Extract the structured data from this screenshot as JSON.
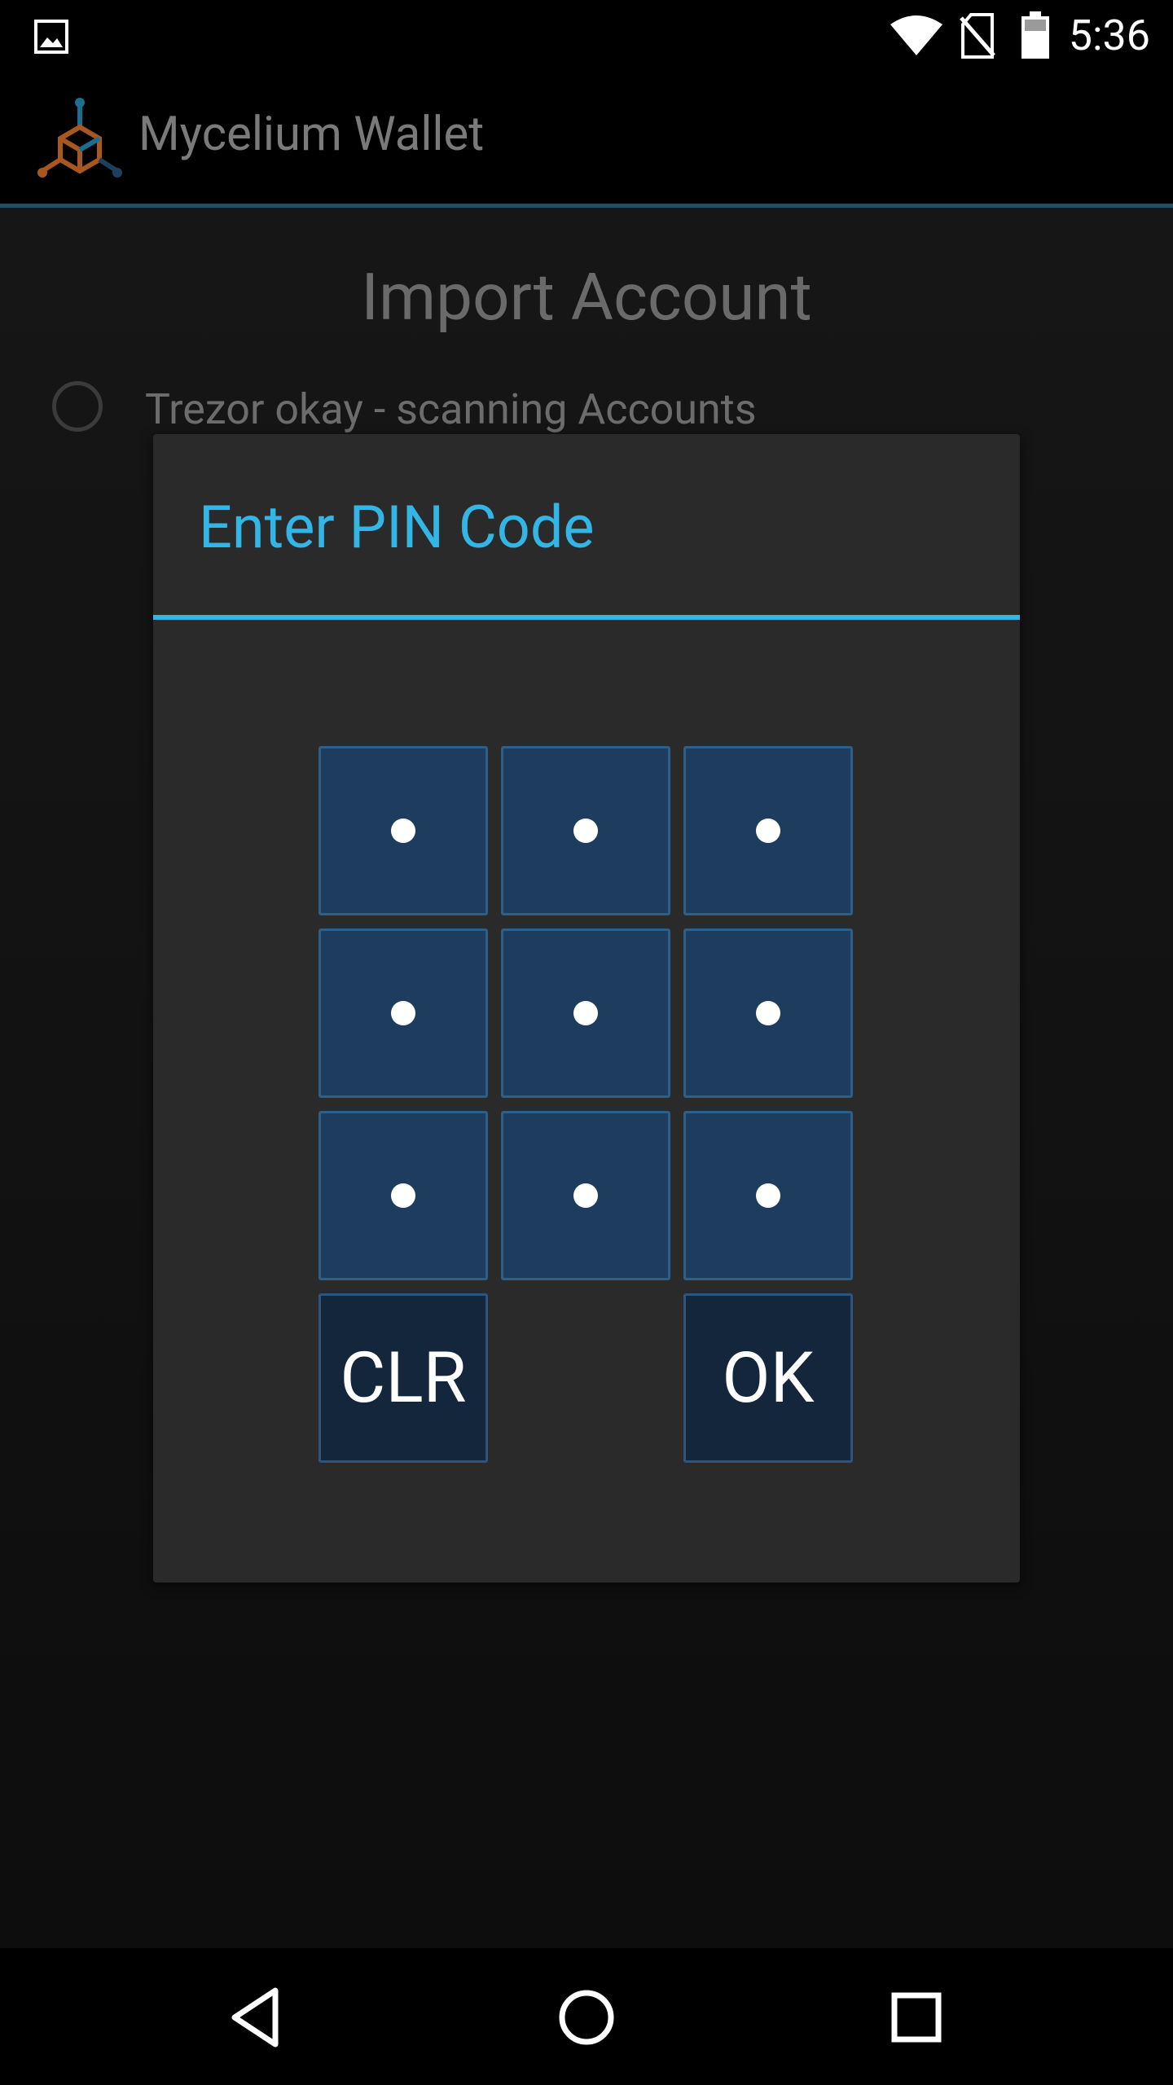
{
  "status_bar": {
    "time": "5:36",
    "icons": [
      "image-notification-icon",
      "wifi-icon",
      "no-sim-icon",
      "battery-icon"
    ]
  },
  "action_bar": {
    "app_title": "Mycelium Wallet",
    "logo": "mycelium-logo-icon"
  },
  "main": {
    "title": "Import Account",
    "status_text": "Trezor okay - scanning Accounts"
  },
  "dialog": {
    "title": "Enter PIN Code",
    "keys": [
      "•",
      "•",
      "•",
      "•",
      "•",
      "•",
      "•",
      "•",
      "•"
    ],
    "clear_label": "CLR",
    "ok_label": "OK"
  },
  "nav_bar": {
    "buttons": [
      "back-icon",
      "home-icon",
      "recents-icon"
    ]
  },
  "colors": {
    "accent": "#33b5e5",
    "pin_button": "#1e3d5e",
    "pin_button_dark": "#13263b",
    "dialog_bg": "#2a2a2a"
  }
}
